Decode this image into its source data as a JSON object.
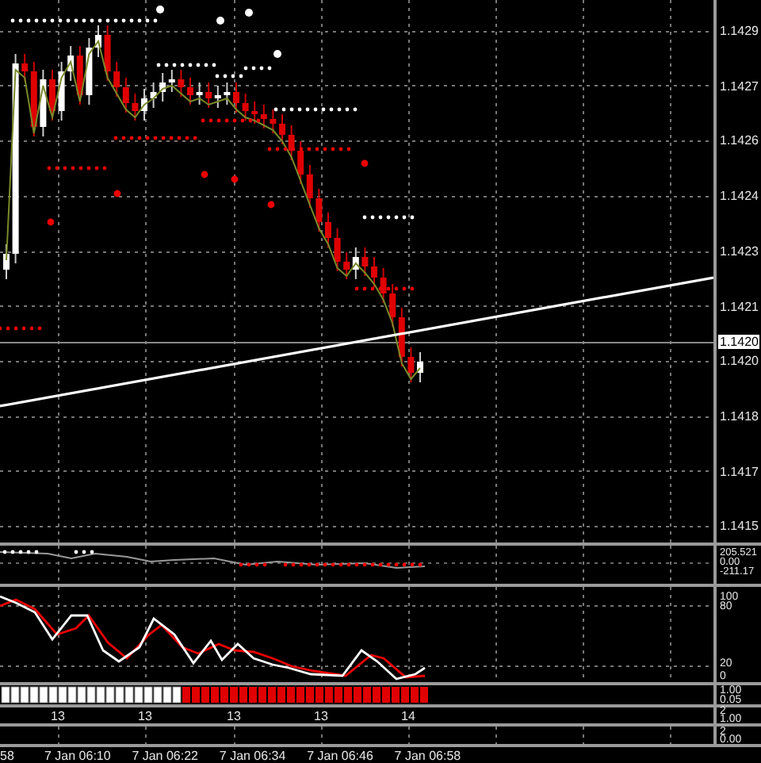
{
  "price_axis": {
    "ticks": [
      "1.1429",
      "1.1427",
      "1.1426",
      "1.1424",
      "1.1423",
      "1.1421",
      "1.1420",
      "1.1418",
      "1.1417",
      "1.1415"
    ],
    "current_price": "1.1420"
  },
  "indicator_panes": [
    {
      "kind": "oscillator",
      "ticks": [
        "205.521",
        "0.00",
        "-211.17"
      ]
    },
    {
      "kind": "stochastic",
      "ticks": [
        "100",
        "80",
        "20",
        "0"
      ]
    },
    {
      "kind": "histogram",
      "ticks": [
        "1.00",
        "0.05"
      ]
    },
    {
      "kind": "counts",
      "ticks": [
        "2",
        "1.00"
      ],
      "labels": [
        "13",
        "13",
        "13",
        "13",
        "14"
      ]
    },
    {
      "kind": "empty",
      "ticks": [
        "2",
        "0.00"
      ]
    }
  ],
  "time_axis": [
    "58",
    "7 Jan 06:10",
    "7 Jan 06:22",
    "7 Jan 06:34",
    "7 Jan 06:46",
    "7 Jan 06:58"
  ]
}
